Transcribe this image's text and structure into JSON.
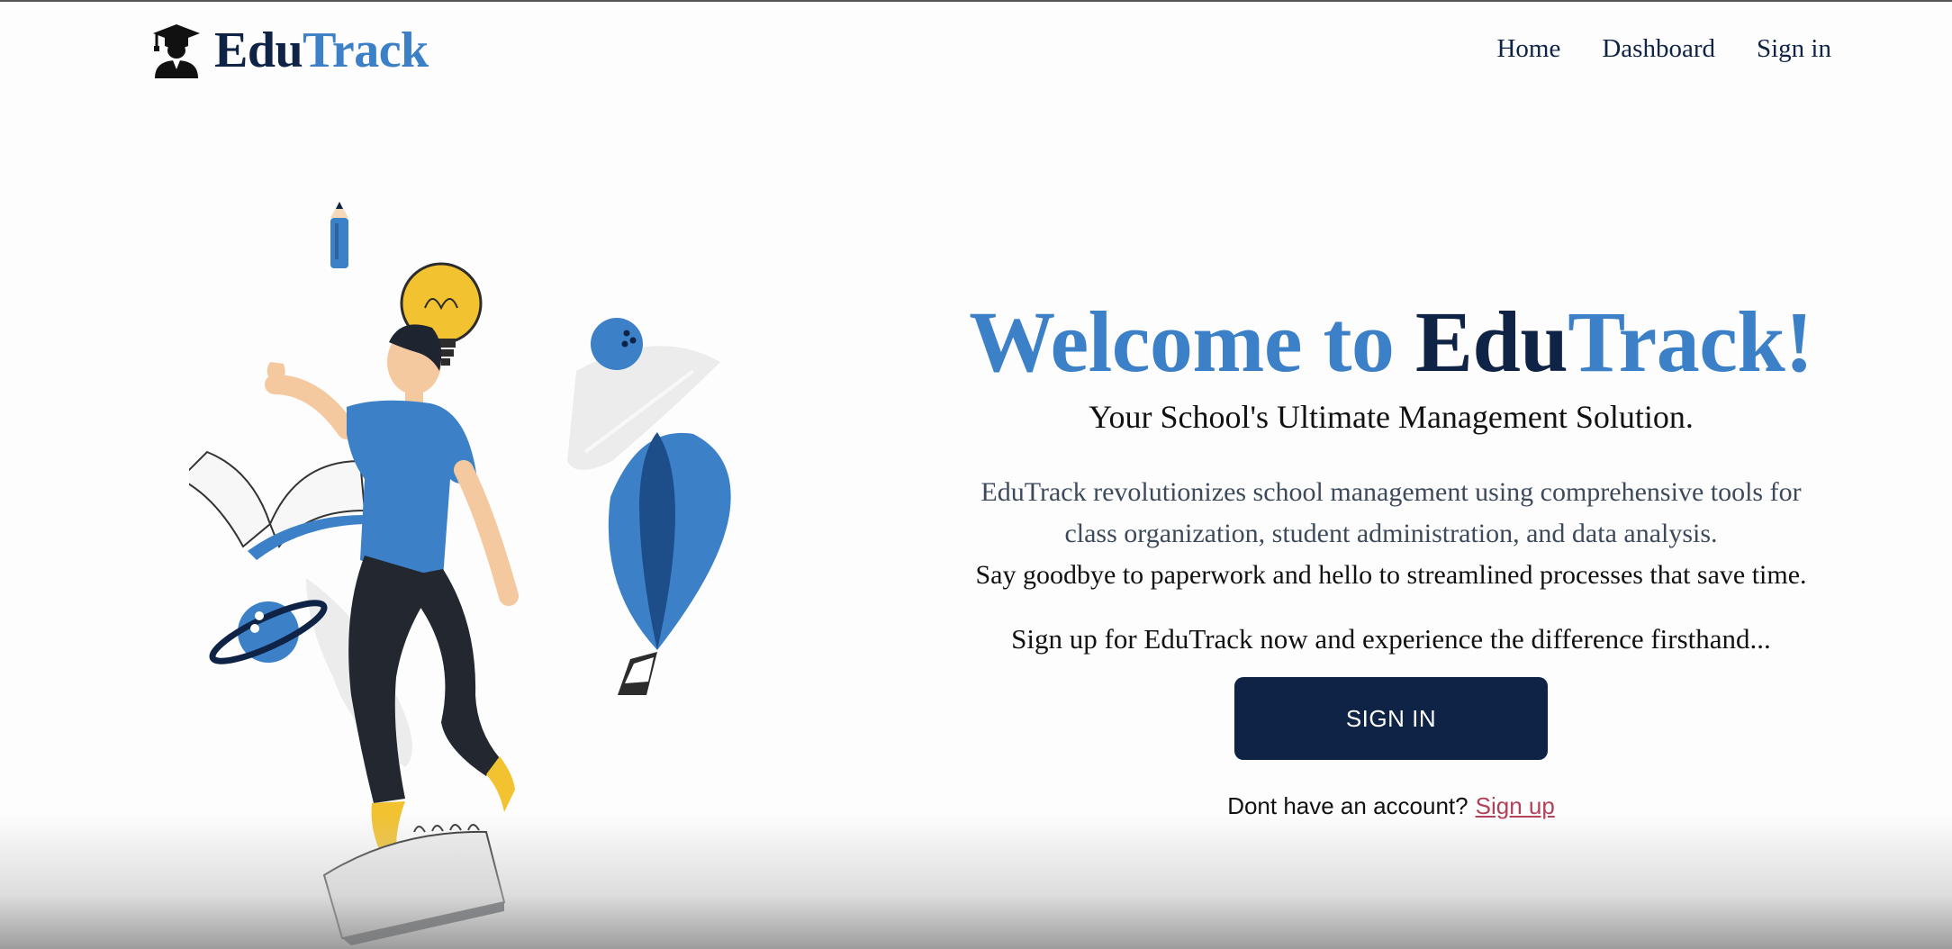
{
  "brand": {
    "name_part1": "Edu",
    "name_part2": "Track",
    "logo_icon": "graduate-cap-icon"
  },
  "nav": {
    "items": [
      {
        "label": "Home"
      },
      {
        "label": "Dashboard"
      },
      {
        "label": "Sign in"
      }
    ]
  },
  "hero": {
    "title_part1": "Welcome to ",
    "title_part2": "Edu",
    "title_part3": "Track!",
    "subtitle": "Your School's Ultimate Management Solution.",
    "desc_line1": "EduTrack revolutionizes school management using comprehensive tools for",
    "desc_line2": "class organization, student administration, and data analysis.",
    "desc_line3": "Say goodbye to paperwork and hello to streamlined processes that save time.",
    "cta_text": "Sign up for EduTrack now and experience the difference firsthand...",
    "signin_button": "SIGN IN",
    "account_prompt": "Dont have an account?",
    "signup_link": "Sign up"
  },
  "colors": {
    "navy": "#0e2345",
    "blue": "#3c80c8",
    "link": "#b2415a",
    "yellow": "#f2c230"
  }
}
